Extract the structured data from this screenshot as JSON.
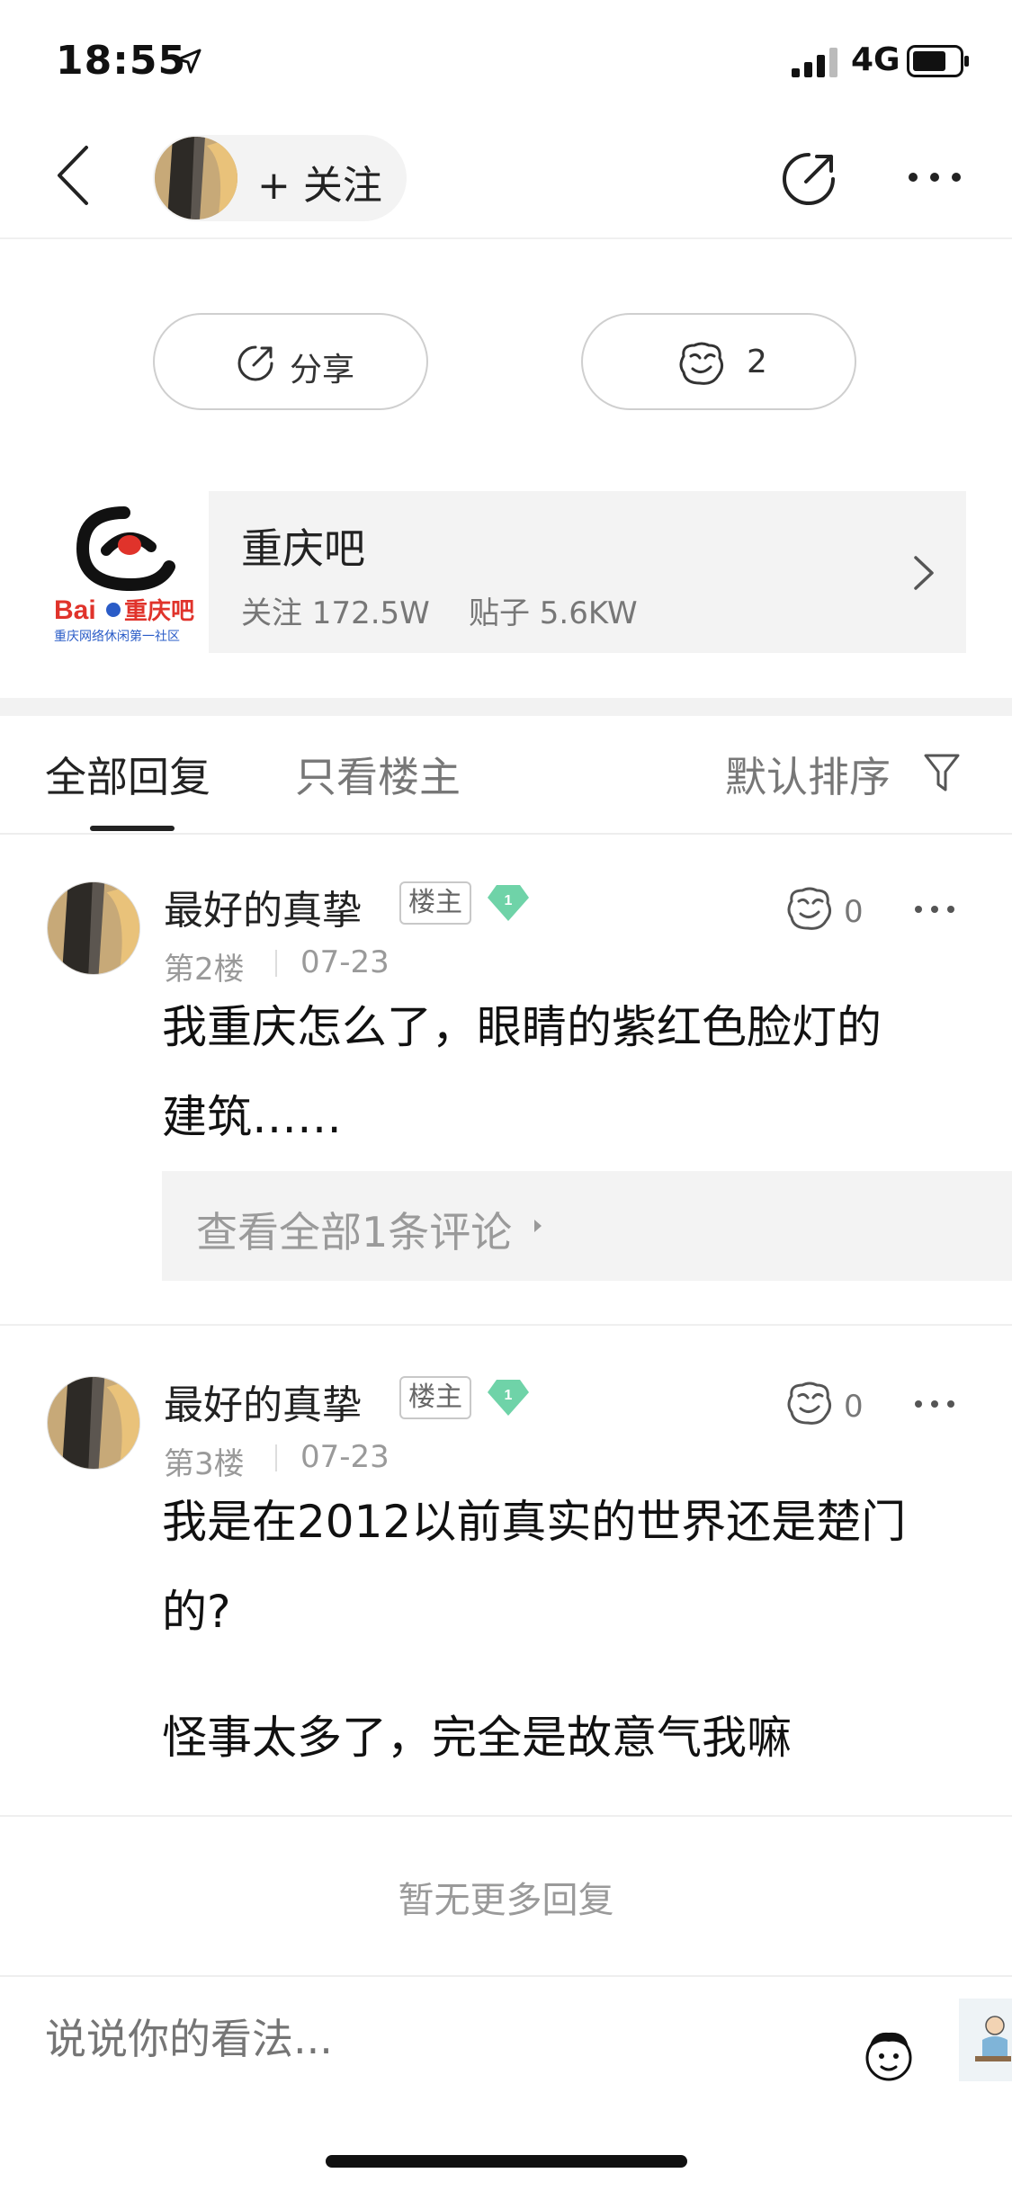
{
  "status_bar": {
    "time": "18:55",
    "network": "4G"
  },
  "nav": {
    "follow_label": "+ 关注"
  },
  "actions": {
    "share_label": "分享",
    "like_count": "2"
  },
  "forum": {
    "name": "重庆吧",
    "stats": "关注 172.5W    贴子 5.6KW",
    "logo_text": "Bai重庆吧",
    "logo_subtitle": "重庆网络休闲第一社区"
  },
  "tabs": {
    "all": "全部回复",
    "owner_only": "只看楼主",
    "sort": "默认排序"
  },
  "replies": [
    {
      "user": "最好的真挚",
      "badge": "楼主",
      "level": "1",
      "floor": "第2楼",
      "date": "07-23",
      "likes": "0",
      "text_lines": [
        "我重庆怎么了，眼睛的紫红色脸灯的",
        "建筑……"
      ],
      "comments_link": "查看全部1条评论"
    },
    {
      "user": "最好的真挚",
      "badge": "楼主",
      "level": "1",
      "floor": "第3楼",
      "date": "07-23",
      "likes": "0",
      "text_lines": [
        "我是在2012以前真实的世界还是楚门",
        "的?",
        "怪事太多了，完全是故意气我嘛"
      ]
    }
  ],
  "no_more": "暂无更多回复",
  "comment_input": {
    "placeholder": "说说你的看法..."
  },
  "colors": {
    "gem_green": "#6fd3a8",
    "logo_red": "#e0332b",
    "logo_blue": "#2a5cc7"
  }
}
